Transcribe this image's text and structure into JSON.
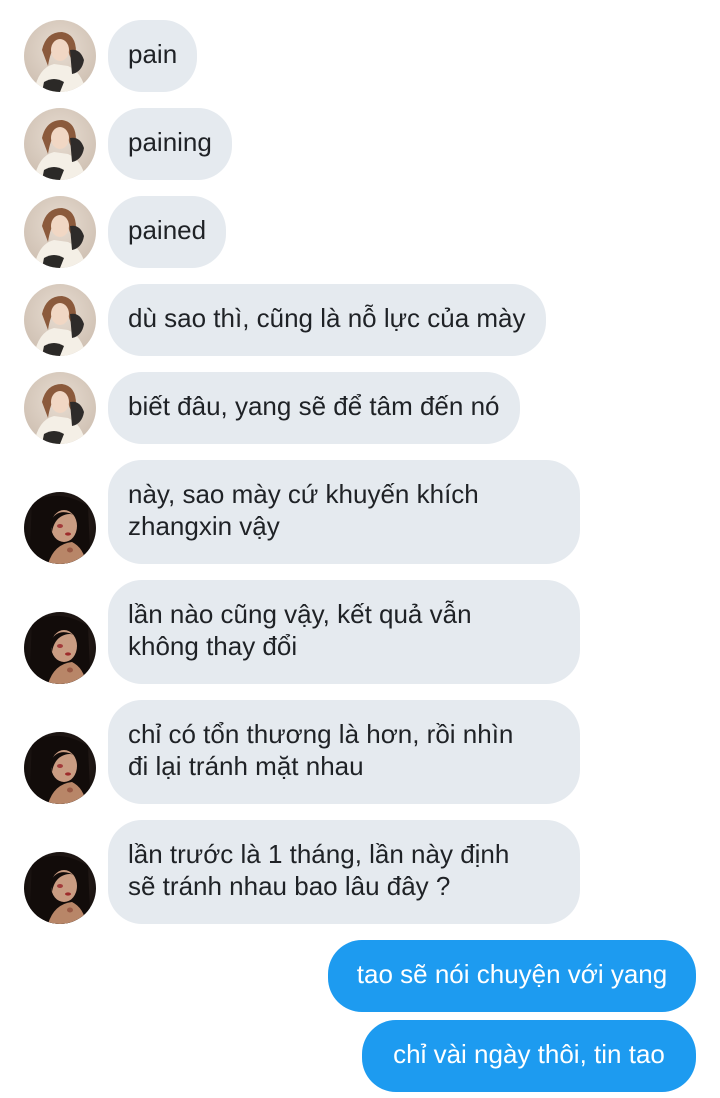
{
  "conversation": {
    "messages": [
      {
        "sender": "contact-a",
        "lines": [
          "pain"
        ]
      },
      {
        "sender": "contact-a",
        "lines": [
          "paining"
        ]
      },
      {
        "sender": "contact-a",
        "lines": [
          "pained"
        ]
      },
      {
        "sender": "contact-a",
        "lines": [
          "dù sao thì, cũng là nỗ lực của mày"
        ]
      },
      {
        "sender": "contact-a",
        "lines": [
          "biết đâu, yang sẽ để tâm đến nó"
        ]
      },
      {
        "sender": "contact-b",
        "lines": [
          "này, sao mày cứ khuyến khích",
          "zhangxin vậy"
        ]
      },
      {
        "sender": "contact-b",
        "lines": [
          "lần nào cũng vậy, kết quả vẫn",
          "không thay đổi"
        ]
      },
      {
        "sender": "contact-b",
        "lines": [
          "chỉ có tổn thương là hơn, rồi nhìn",
          "đi lại tránh mặt nhau"
        ]
      },
      {
        "sender": "contact-b",
        "lines": [
          "lần trước là 1 tháng, lần này định",
          "sẽ tránh nhau bao lâu đây ?"
        ]
      },
      {
        "sender": "me",
        "lines": [
          "tao sẽ nói chuyện với yang"
        ]
      },
      {
        "sender": "me",
        "lines": [
          "chỉ vài ngày thôi, tin tao"
        ]
      }
    ]
  },
  "colors": {
    "incoming_bubble": "#e5eaef",
    "outgoing_bubble": "#1d9bf0",
    "incoming_text": "#1f2226",
    "outgoing_text": "#ffffff"
  },
  "icons": {
    "contact_a_avatar": "avatar-icon",
    "contact_b_avatar": "avatar-icon"
  }
}
